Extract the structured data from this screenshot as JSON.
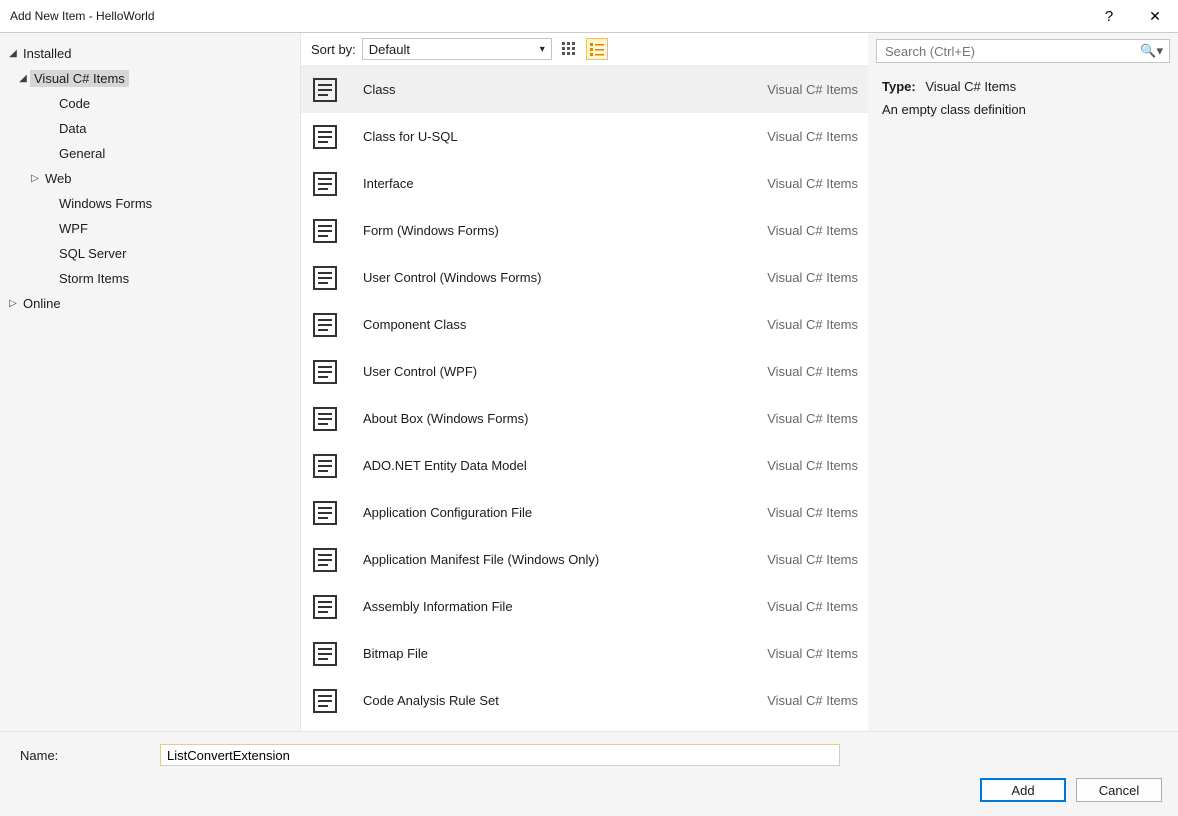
{
  "title": "Add New Item - HelloWorld",
  "titlebar": {
    "help": "?",
    "close": "✕"
  },
  "tree": {
    "installed": "Installed",
    "online": "Online",
    "vcs_items": "Visual C# Items",
    "children": [
      "Code",
      "Data",
      "General",
      "Web",
      "Windows Forms",
      "WPF",
      "SQL Server",
      "Storm Items"
    ]
  },
  "sort": {
    "label": "Sort by:",
    "value": "Default"
  },
  "search": {
    "placeholder": "Search (Ctrl+E)"
  },
  "items": [
    {
      "name": "Class",
      "cat": "Visual C# Items"
    },
    {
      "name": "Class for U-SQL",
      "cat": "Visual C# Items"
    },
    {
      "name": "Interface",
      "cat": "Visual C# Items"
    },
    {
      "name": "Form (Windows Forms)",
      "cat": "Visual C# Items"
    },
    {
      "name": "User Control (Windows Forms)",
      "cat": "Visual C# Items"
    },
    {
      "name": "Component Class",
      "cat": "Visual C# Items"
    },
    {
      "name": "User Control (WPF)",
      "cat": "Visual C# Items"
    },
    {
      "name": "About Box (Windows Forms)",
      "cat": "Visual C# Items"
    },
    {
      "name": "ADO.NET Entity Data Model",
      "cat": "Visual C# Items"
    },
    {
      "name": "Application Configuration File",
      "cat": "Visual C# Items"
    },
    {
      "name": "Application Manifest File (Windows Only)",
      "cat": "Visual C# Items"
    },
    {
      "name": "Assembly Information File",
      "cat": "Visual C# Items"
    },
    {
      "name": "Bitmap File",
      "cat": "Visual C# Items"
    },
    {
      "name": "Code Analysis Rule Set",
      "cat": "Visual C# Items"
    }
  ],
  "details": {
    "type_label": "Type:",
    "type_value": "Visual C# Items",
    "description": "An empty class definition"
  },
  "bottom": {
    "name_label": "Name:",
    "name_value": "ListConvertExtension",
    "add": "Add",
    "cancel": "Cancel"
  }
}
